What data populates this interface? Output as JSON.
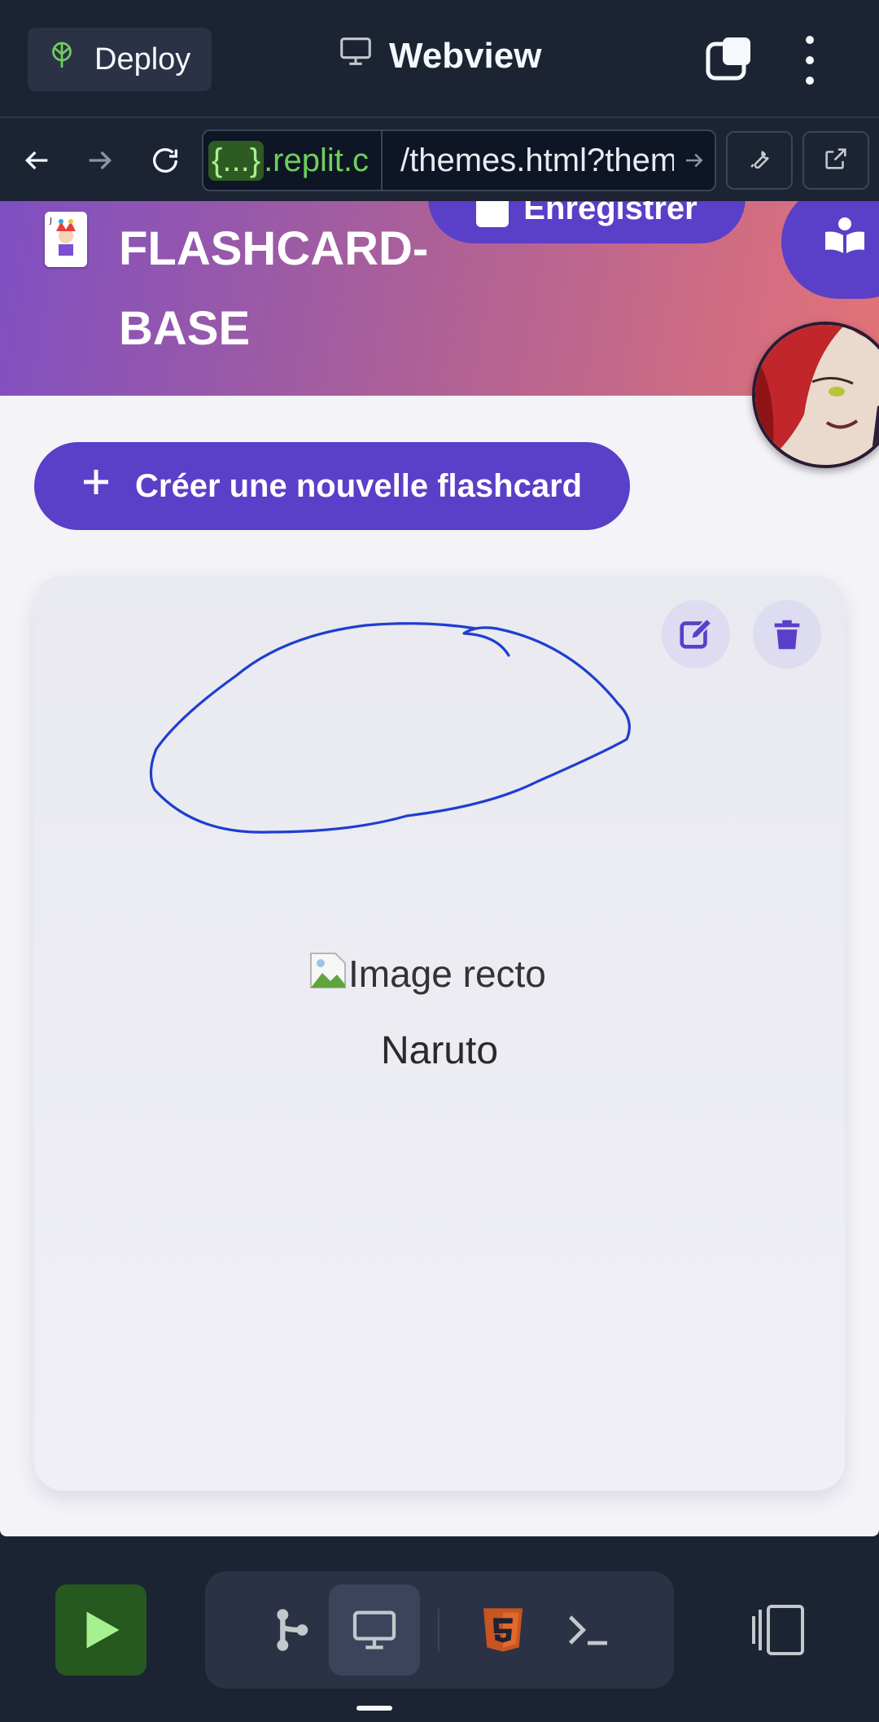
{
  "topbar": {
    "deploy_label": "Deploy",
    "title": "Webview"
  },
  "urlbar": {
    "host_prefix": "{...}",
    "host_suffix": ".replit.c",
    "path": "/themes.html?them"
  },
  "app": {
    "title_line1": "FLASHCARD-",
    "title_line2": "BASE",
    "save_label": "Enregistrer",
    "create_label": "Créer une nouvelle flashcard",
    "accent_color": "#5a3fc8"
  },
  "card": {
    "image_alt": "Image recto",
    "word": "Naruto"
  },
  "bottombar": {
    "tools": [
      "git-icon",
      "webview-icon",
      "html5-icon",
      "shell-icon"
    ],
    "active_tool": "webview-icon"
  }
}
